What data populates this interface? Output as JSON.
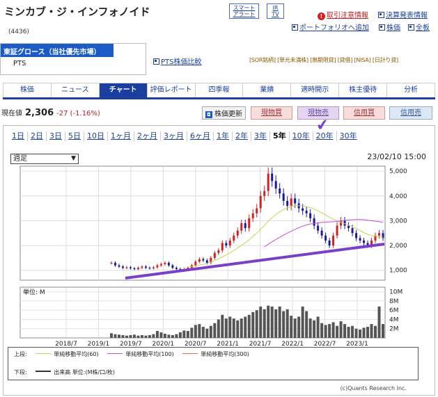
{
  "header": {
    "title": "ミンカブ・ジ・インフォノイド",
    "code": "(4436)",
    "smart_alert": [
      "スマート",
      "アラート"
    ],
    "ir_tv": [
      "IR",
      "TV"
    ],
    "caution_link": "取引注意情報",
    "earnings_link": "決算発表情報",
    "portfolio_link": "ポートフォリオへ追加",
    "stock_price_link": "株価",
    "all_boards_link": "全板"
  },
  "market": {
    "selected": "東証グロース（当社優先市場）",
    "option": "PTS"
  },
  "pts_compare": "PTS株価比較",
  "tags": "[SOR銘柄] [単元未満株] [無期限貸] [貸借] [NISA] [日計り貸]",
  "tabs": [
    "株価",
    "ニュース",
    "チャート",
    "評価レポート",
    "四季報",
    "業績",
    "適時開示",
    "株主優待",
    "分析"
  ],
  "active_tab": "チャート",
  "price": {
    "label": "現在値",
    "value": "2,306",
    "change": "-27 (-1.16%)"
  },
  "buttons": {
    "update": "株価更新",
    "genbutsu_buy": "現物買",
    "genbutsu_sell": "現物売",
    "shinyo_buy": "信用買",
    "shinyo_sell": "信用売"
  },
  "periods": [
    "1日",
    "2日",
    "3日",
    "5日",
    "10日",
    "1ヶ月",
    "2ヶ月",
    "3ヶ月",
    "6ヶ月",
    "1年",
    "2年",
    "3年",
    "5年",
    "10年",
    "20年",
    "30年"
  ],
  "active_period": "5年",
  "frequency": "週足",
  "timestamp": "23/02/10 15:00",
  "volume_unit": "単位: M",
  "legend": {
    "upper": "上段:",
    "ma60": "単純移動平均(60)",
    "ma100": "単純移動平均(100)",
    "ma300": "単純移動平均(300)",
    "lower": "下段:",
    "volume": "出来高 単位:(M株/口/枚)"
  },
  "credit": "(c)Quants Research Inc.",
  "colors": {
    "accent": "#1a3f9e",
    "ma60": "#c8d64a",
    "ma100": "#c44bd6",
    "ma300": "#e86a4a",
    "trendline": "#7a3fc8",
    "up_candle": "#d22020",
    "down_candle": "#1a1aa0"
  },
  "chart_data": {
    "type": "candlestick",
    "x_ticks": [
      "2018/7",
      "2019/1",
      "2019/7",
      "2020/1",
      "2020/7",
      "2021/1",
      "2021/7",
      "2022/1",
      "2022/7",
      "2023/1"
    ],
    "price_ticks": [
      1000,
      2000,
      3000,
      4000,
      5000
    ],
    "price_ylim": [
      600,
      5200
    ],
    "volume_ticks": [
      "2M",
      "4M",
      "6M",
      "8M",
      "10M"
    ],
    "volume_ylim": [
      0,
      11
    ],
    "close_weekly": [
      1300,
      1200,
      1150,
      1100,
      1120,
      1080,
      1050,
      1100,
      1150,
      1100,
      1080,
      1120,
      1200,
      1250,
      1300,
      1200,
      1100,
      1050,
      1000,
      1050,
      1100,
      1200,
      1350,
      1450,
      1400,
      1300,
      1500,
      1700,
      1800,
      2100,
      2000,
      2200,
      2400,
      2600,
      2900,
      2700,
      3100,
      3300,
      3500,
      4000,
      4200,
      4900,
      4600,
      4300,
      4100,
      3800,
      3600,
      3900,
      3700,
      3500,
      3400,
      3300,
      3100,
      2800,
      2600,
      2400,
      2200,
      2000,
      2400,
      2800,
      3000,
      2800,
      2700,
      2500,
      2300,
      2200,
      2100,
      2000,
      2200,
      2400,
      2500,
      2300
    ],
    "ma60": [
      null,
      null,
      null,
      null,
      null,
      null,
      null,
      null,
      null,
      null,
      null,
      null,
      null,
      null,
      null,
      null,
      null,
      null,
      null,
      null,
      1120,
      1150,
      1180,
      1210,
      1240,
      1280,
      1330,
      1390,
      1460,
      1540,
      1620,
      1710,
      1800,
      1900,
      2010,
      2110,
      2230,
      2360,
      2500,
      2650,
      2810,
      2980,
      3120,
      3250,
      3360,
      3450,
      3520,
      3580,
      3600,
      3610,
      3600,
      3570,
      3530,
      3470,
      3400,
      3320,
      3230,
      3140,
      3060,
      2990,
      2930,
      2880,
      2820,
      2750,
      2680,
      2600,
      2520,
      2450,
      2400,
      2370,
      2350,
      2330
    ],
    "ma100": [
      null,
      null,
      null,
      null,
      null,
      null,
      null,
      null,
      null,
      null,
      null,
      null,
      null,
      null,
      null,
      null,
      null,
      null,
      null,
      null,
      null,
      null,
      null,
      null,
      null,
      null,
      null,
      null,
      null,
      null,
      null,
      null,
      null,
      null,
      null,
      null,
      null,
      null,
      null,
      null,
      1950,
      2050,
      2150,
      2240,
      2330,
      2420,
      2500,
      2580,
      2650,
      2720,
      2780,
      2830,
      2870,
      2890,
      2910,
      2930,
      2940,
      2950,
      2960,
      2970,
      2990,
      3010,
      3030,
      3040,
      3050,
      3050,
      3040,
      3020,
      3000,
      2980,
      2960,
      2930
    ],
    "volume": [
      1,
      0.8,
      0.7,
      0.6,
      0.5,
      0.6,
      0.7,
      0.5,
      0.6,
      0.5,
      0.6,
      0.8,
      1.5,
      1.2,
      0.9,
      0.7,
      0.6,
      0.8,
      1.2,
      1.6,
      1.5,
      2.2,
      2.8,
      3,
      2.4,
      2,
      2.6,
      3.2,
      4,
      5,
      4.2,
      4.6,
      4.2,
      3.8,
      4.2,
      4.6,
      5,
      5.6,
      6,
      6.8,
      6.2,
      7,
      6.8,
      6.2,
      6.8,
      5.8,
      6.2,
      4.8,
      4.2,
      4.6,
      6.8,
      5.8,
      4.2,
      3.8,
      4.6,
      3.2,
      2.8,
      3,
      3.4,
      2.6,
      3.6,
      3,
      2.4,
      2.6,
      2,
      1.8,
      2.2,
      2.4,
      3,
      2.6,
      6.8,
      3
    ]
  }
}
